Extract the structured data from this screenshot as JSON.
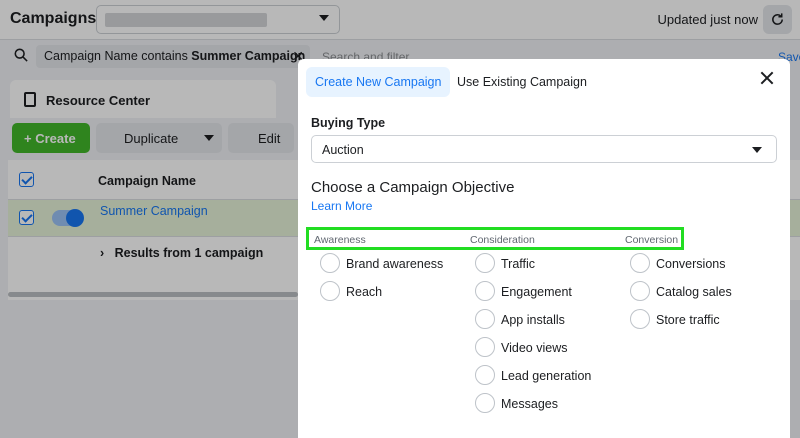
{
  "app": {
    "title": "Campaigns",
    "updated_text": "Updated just now",
    "refresh_icon": "refresh-icon"
  },
  "filter": {
    "chip_prefix": "Campaign Name contains ",
    "chip_value": "Summer Campaign",
    "search_placeholder": "Search and filter",
    "save_label": "Save"
  },
  "resource_center": {
    "label": "Resource Center"
  },
  "toolbar": {
    "create_label": "Create",
    "duplicate_label": "Duplicate",
    "edit_label": "Edit"
  },
  "table": {
    "header_name": "Campaign Name",
    "rows": [
      {
        "name": "Summer Campaign",
        "status_on": true
      }
    ],
    "results_label": "Results from 1 campaign"
  },
  "modal": {
    "tabs": [
      {
        "label": "Create New Campaign",
        "active": true
      },
      {
        "label": "Use Existing Campaign",
        "active": false
      }
    ],
    "buying_type_label": "Buying Type",
    "buying_type_value": "Auction",
    "objective_title": "Choose a Campaign Objective",
    "learn_more": "Learn More",
    "highlight_color": "#22dd22",
    "columns": [
      {
        "heading": "Awareness",
        "options": [
          "Brand awareness",
          "Reach"
        ]
      },
      {
        "heading": "Consideration",
        "options": [
          "Traffic",
          "Engagement",
          "App installs",
          "Video views",
          "Lead generation",
          "Messages"
        ]
      },
      {
        "heading": "Conversion",
        "options": [
          "Conversions",
          "Catalog sales",
          "Store traffic"
        ]
      }
    ]
  },
  "colors": {
    "accent": "#1877f2",
    "create_green": "#42b72a",
    "selected_row": "#e7f3d9"
  }
}
